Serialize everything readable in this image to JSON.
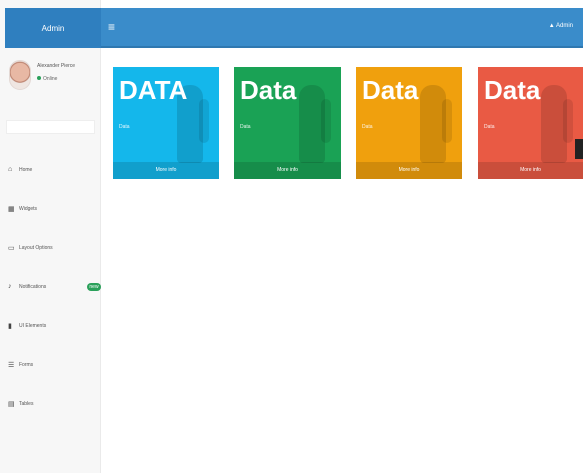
{
  "brand": {
    "label": "Admin"
  },
  "header": {
    "user_label": "Admin"
  },
  "user": {
    "name": "Alexander Pierce",
    "status": "Online"
  },
  "sidebar": {
    "items": [
      {
        "label": "Home",
        "icon": "home-icon"
      },
      {
        "label": "Widgets",
        "icon": "grid-icon"
      },
      {
        "label": "Layout Options",
        "icon": "layout-icon"
      },
      {
        "label": "Notifications",
        "icon": "bell-icon",
        "badge": "new"
      },
      {
        "label": "UI Elements",
        "icon": "phone-icon"
      },
      {
        "label": "Forms",
        "icon": "form-icon"
      },
      {
        "label": "Tables",
        "icon": "table-icon"
      }
    ]
  },
  "cards": [
    {
      "title": "DATA",
      "sub": "Data",
      "footer": "More info",
      "color": "#14b7eb"
    },
    {
      "title": "Data",
      "sub": "Data",
      "footer": "More info",
      "color": "#1aa255"
    },
    {
      "title": "Data",
      "sub": "Data",
      "footer": "More info",
      "color": "#f0a00d"
    },
    {
      "title": "Data",
      "sub": "Data",
      "footer": "More info",
      "color": "#e95a44"
    }
  ]
}
